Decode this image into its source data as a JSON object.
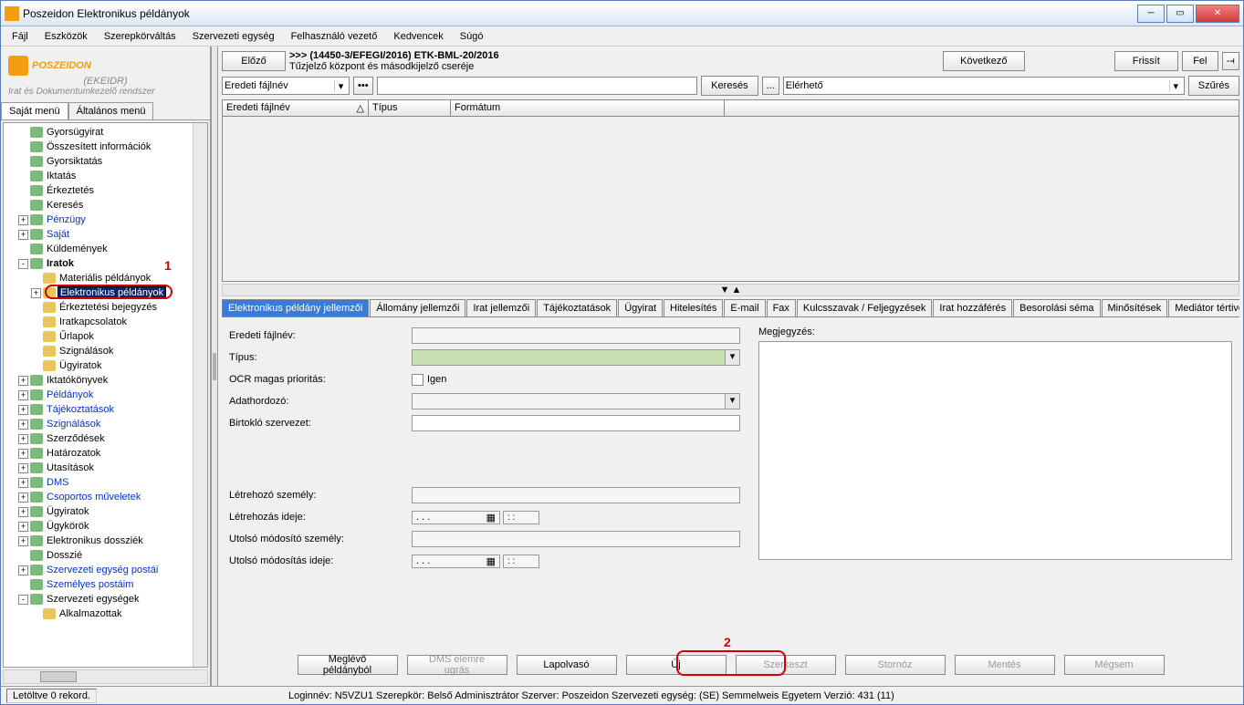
{
  "window_title": "Poszeidon Elektronikus példányok",
  "menus": [
    "Fájl",
    "Eszközök",
    "Szerepkörváltás",
    "Szervezeti egység",
    "Felhasználó vezető",
    "Kedvencek",
    "Súgó"
  ],
  "logo": {
    "main": "POSZEIDON",
    "sub": "(EKEIDR)",
    "desc": "Irat és Dokumentumkezelő rendszer"
  },
  "side_tabs": [
    "Saját menü",
    "Általános menü"
  ],
  "tree": [
    {
      "i": 1,
      "lbl": "Gyorsügyirat",
      "ic": "green"
    },
    {
      "i": 1,
      "lbl": "Összesített információk",
      "ic": "green"
    },
    {
      "i": 1,
      "lbl": "Gyorsiktatás",
      "ic": "green"
    },
    {
      "i": 1,
      "lbl": "Iktatás",
      "ic": "green"
    },
    {
      "i": 1,
      "lbl": "Érkeztetés",
      "ic": "green"
    },
    {
      "i": 1,
      "lbl": "Keresés",
      "ic": "green"
    },
    {
      "i": 1,
      "exp": "+",
      "lbl": "Pénzügy",
      "ic": "green",
      "blue": true
    },
    {
      "i": 1,
      "exp": "+",
      "lbl": "Saját",
      "ic": "green",
      "blue": true
    },
    {
      "i": 1,
      "lbl": "Küldemények",
      "ic": "green"
    },
    {
      "i": 1,
      "exp": "-",
      "lbl": "Iratok",
      "ic": "green",
      "bold": true
    },
    {
      "i": 2,
      "lbl": "Materiális példányok",
      "ic": "yel"
    },
    {
      "i": 2,
      "exp": "+",
      "lbl": "Elektronikus példányok",
      "ic": "yel",
      "sel": true
    },
    {
      "i": 2,
      "lbl": "Érkeztetési bejegyzés",
      "ic": "yel"
    },
    {
      "i": 2,
      "lbl": "Iratkapcsolatok",
      "ic": "yel"
    },
    {
      "i": 2,
      "lbl": "Űrlapok",
      "ic": "yel"
    },
    {
      "i": 2,
      "lbl": "Szignálások",
      "ic": "yel"
    },
    {
      "i": 2,
      "lbl": "Ügyiratok",
      "ic": "yel"
    },
    {
      "i": 1,
      "exp": "+",
      "lbl": "Iktatókönyvek",
      "ic": "green"
    },
    {
      "i": 1,
      "exp": "+",
      "lbl": "Példányok",
      "ic": "green",
      "blue": true
    },
    {
      "i": 1,
      "exp": "+",
      "lbl": "Tájékoztatások",
      "ic": "green",
      "blue": true
    },
    {
      "i": 1,
      "exp": "+",
      "lbl": "Szignálások",
      "ic": "green",
      "blue": true
    },
    {
      "i": 1,
      "exp": "+",
      "lbl": "Szerződések",
      "ic": "green"
    },
    {
      "i": 1,
      "exp": "+",
      "lbl": "Határozatok",
      "ic": "green"
    },
    {
      "i": 1,
      "exp": "+",
      "lbl": "Utasítások",
      "ic": "green"
    },
    {
      "i": 1,
      "exp": "+",
      "lbl": "DMS",
      "ic": "green",
      "blue": true
    },
    {
      "i": 1,
      "exp": "+",
      "lbl": "Csoportos műveletek",
      "ic": "green",
      "blue": true
    },
    {
      "i": 1,
      "exp": "+",
      "lbl": "Ügyiratok",
      "ic": "green"
    },
    {
      "i": 1,
      "exp": "+",
      "lbl": "Ügykörök",
      "ic": "green"
    },
    {
      "i": 1,
      "exp": "+",
      "lbl": "Elektronikus dossziék",
      "ic": "green"
    },
    {
      "i": 1,
      "lbl": "Dosszié",
      "ic": "green"
    },
    {
      "i": 1,
      "exp": "+",
      "lbl": "Szervezeti egység postái",
      "ic": "green",
      "blue": true
    },
    {
      "i": 1,
      "lbl": "Személyes postáim",
      "ic": "green",
      "blue": true
    },
    {
      "i": 1,
      "exp": "-",
      "lbl": "Szervezeti egységek",
      "ic": "green"
    },
    {
      "i": 2,
      "lbl": "Alkalmazottak",
      "ic": "yel"
    }
  ],
  "annotations": {
    "num1": "1",
    "num2": "2"
  },
  "topbar": {
    "prev": "Előző",
    "next": "Következő",
    "refresh": "Frissít",
    "up": "Fel",
    "bc1": ">>> (14450-3/EFEGI/2016) ETK-BML-20/2016",
    "bc2": "Tűzjelző központ és másodkijelző cseréje"
  },
  "search": {
    "field_combo": "Eredeti fájlnév",
    "search_btn": "Keresés",
    "more": "...",
    "scope": "Elérhető",
    "filter": "Szűrés"
  },
  "grid_cols": [
    "Eredeti fájlnév",
    "Típus",
    "Formátum"
  ],
  "tabs": [
    "Elektronikus példány jellemzői",
    "Állomány jellemzői",
    "Irat jellemzői",
    "Tájékoztatások",
    "Ügyirat",
    "Hitelesítés",
    "E-mail",
    "Fax",
    "Kulcsszavak / Feljegyzések",
    "Irat hozzáférés",
    "Besorolási séma",
    "Minősítések",
    "Mediátor tértivevény"
  ],
  "form": {
    "orig_file": "Eredeti fájlnév:",
    "type": "Típus:",
    "ocr": "OCR magas prioritás:",
    "ocr_val": "Igen",
    "media": "Adathordozó:",
    "org": "Birtokló szervezet:",
    "creator": "Létrehozó személy:",
    "created": "Létrehozás ideje:",
    "modifier": "Utolsó módosító személy:",
    "modified": "Utolsó módosítás ideje:",
    "note": "Megjegyzés:",
    "date_placeholder": ". . .",
    "time_placeholder": ": :"
  },
  "bottom": {
    "from_existing": "Meglévő példányból",
    "dms": "DMS elemre ugrás",
    "scanner": "Lapolvasó",
    "new": "Új",
    "edit": "Szerkeszt",
    "storno": "Stornóz",
    "save": "Mentés",
    "cancel": "Mégsem"
  },
  "status": {
    "left": "Letöltve 0 rekord.",
    "right": "Loginnév: N5VZU1    Szerepkör: Belső Adminisztrátor    Szerver: Poszeidon    Szervezeti egység: (SE) Semmelweis Egyetem   Verzió: 431 (11)"
  }
}
